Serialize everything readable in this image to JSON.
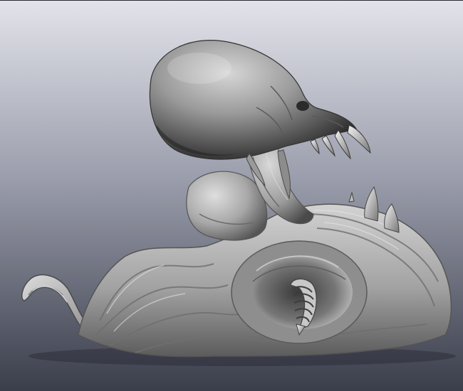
{
  "scene": {
    "background_top": "#e2e3ea",
    "background_mid": "#9b9eac",
    "background_bottom": "#3a3d4a",
    "material_highlight": "#f2f2f2",
    "material_base": "#a4a4a4",
    "material_shadow": "#3c3c3c",
    "subject": "clay-sculpt-creature"
  }
}
